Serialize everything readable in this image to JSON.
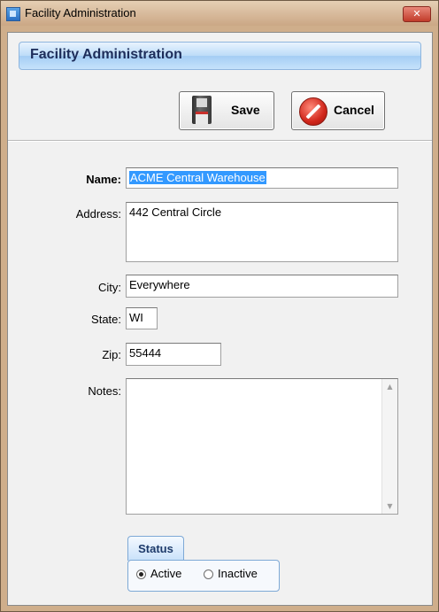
{
  "window": {
    "title": "Facility Administration",
    "close_glyph": "✕",
    "app_icon": "app-icon"
  },
  "header": {
    "title": "Facility Administration"
  },
  "toolbar": {
    "save_label": "Save",
    "save_icon": "floppy-disk-icon",
    "cancel_label": "Cancel",
    "cancel_icon": "no-entry-icon"
  },
  "form": {
    "name_label": "Name:",
    "name_value": "ACME Central Warehouse",
    "address_label": "Address:",
    "address_value": "442 Central Circle",
    "city_label": "City:",
    "city_value": "Everywhere",
    "state_label": "State:",
    "state_value": "WI",
    "zip_label": "Zip:",
    "zip_value": "55444",
    "notes_label": "Notes:",
    "notes_value": ""
  },
  "status": {
    "group_label": "Status",
    "options": [
      {
        "label": "Active",
        "selected": true
      },
      {
        "label": "Inactive",
        "selected": false
      }
    ]
  },
  "colors": {
    "header_text": "#1d2d5a",
    "selection": "#3399ff",
    "window_frame": "#cfae8b"
  }
}
